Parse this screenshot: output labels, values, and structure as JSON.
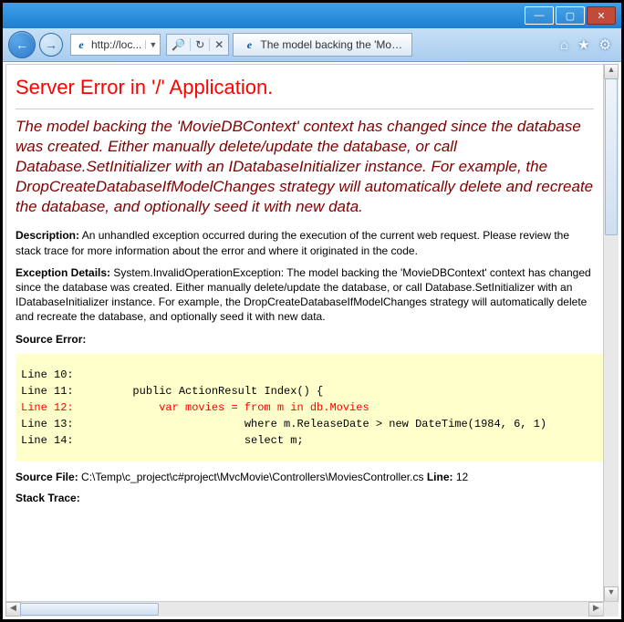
{
  "titlebar": {
    "minimize": "—",
    "maximize": "▢",
    "close": "✕"
  },
  "toolbar": {
    "back_arrow": "←",
    "forward_arrow": "→",
    "url_display": "http://loc...",
    "dropdown_glyph": "▼",
    "refresh_glyph": "↻",
    "stop_glyph": "✕",
    "search_glyph": "🔍",
    "tab_title": "The model backing the 'Movi...",
    "home_glyph": "⌂",
    "fav_glyph": "★",
    "gear_glyph": "⚙"
  },
  "page": {
    "heading": "Server Error in '/' Application.",
    "subheading": "The model backing the 'MovieDBContext' context has changed since the database was created. Either manually delete/update the database, or call Database.SetInitializer with an IDatabaseInitializer instance. For example, the DropCreateDatabaseIfModelChanges strategy will automatically delete and recreate the database, and optionally seed it with new data.",
    "description_label": "Description:",
    "description_text": " An unhandled exception occurred during the execution of the current web request. Please review the stack trace for more information about the error and where it originated in the code.",
    "exception_label": "Exception Details:",
    "exception_text": " System.InvalidOperationException: The model backing the 'MovieDBContext' context has changed since the database was created. Either manually delete/update the database, or call Database.SetInitializer with an IDatabaseInitializer instance. For example, the DropCreateDatabaseIfModelChanges strategy will automatically delete and recreate the database, and optionally seed it with new data.",
    "source_error_label": "Source Error:",
    "code_lines": {
      "l10": "Line 10:",
      "l11": "Line 11:         public ActionResult Index() {",
      "l12": "Line 12:             var movies = from m in db.Movies",
      "l13": "Line 13:                          where m.ReleaseDate > new DateTime(1984, 6, 1)",
      "l14": "Line 14:                          select m;"
    },
    "source_file_label": "Source File:",
    "source_file_path": " C:\\Temp\\c_project\\c#project\\MvcMovie\\Controllers\\MoviesController.cs",
    "line_label": "    Line:",
    "line_number": " 12",
    "stack_trace_label": "Stack Trace:"
  }
}
